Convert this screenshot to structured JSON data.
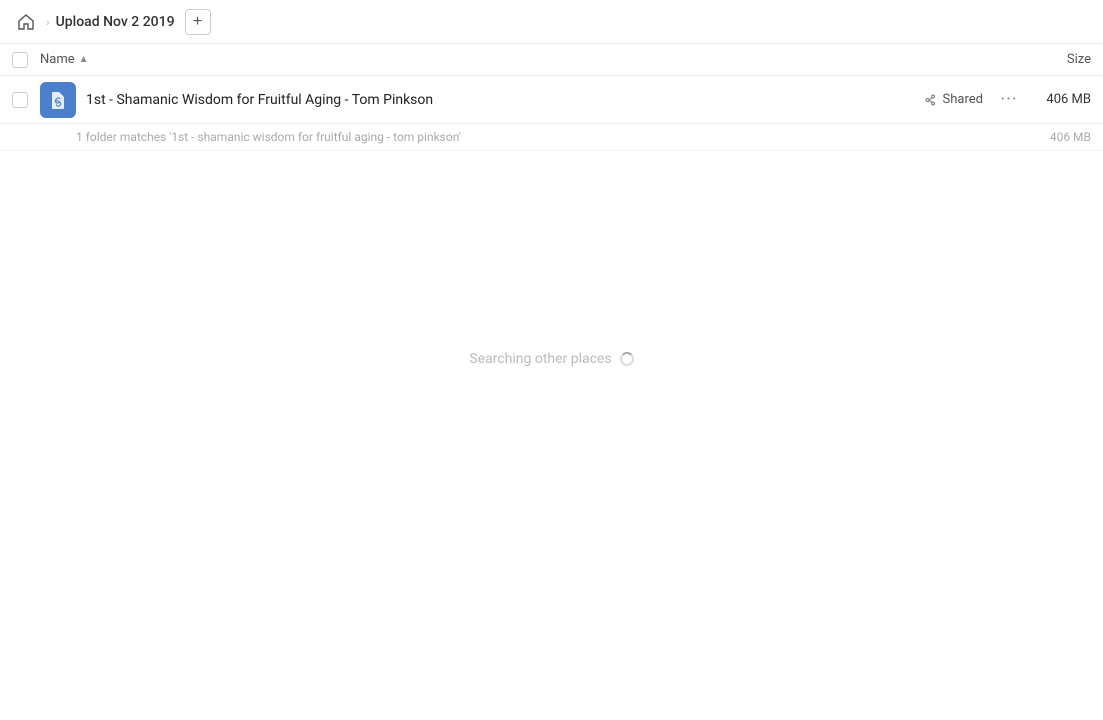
{
  "topbar": {
    "breadcrumb": "Upload Nov 2 2019",
    "add_label": "+",
    "home_icon": "home"
  },
  "column_header": {
    "name_label": "Name",
    "sort_arrow": "▲",
    "size_label": "Size"
  },
  "file_row": {
    "icon_color": "#4a7fcb",
    "name": "1st - Shamanic Wisdom for Fruitful Aging - Tom Pinkson",
    "shared_label": "Shared",
    "more_icon": "•••",
    "size": "406 MB"
  },
  "sub_info": {
    "text": "1 folder matches '1st - shamanic wisdom for fruitful aging - tom pinkson'",
    "size": "406 MB"
  },
  "searching": {
    "text": "Searching other places"
  }
}
